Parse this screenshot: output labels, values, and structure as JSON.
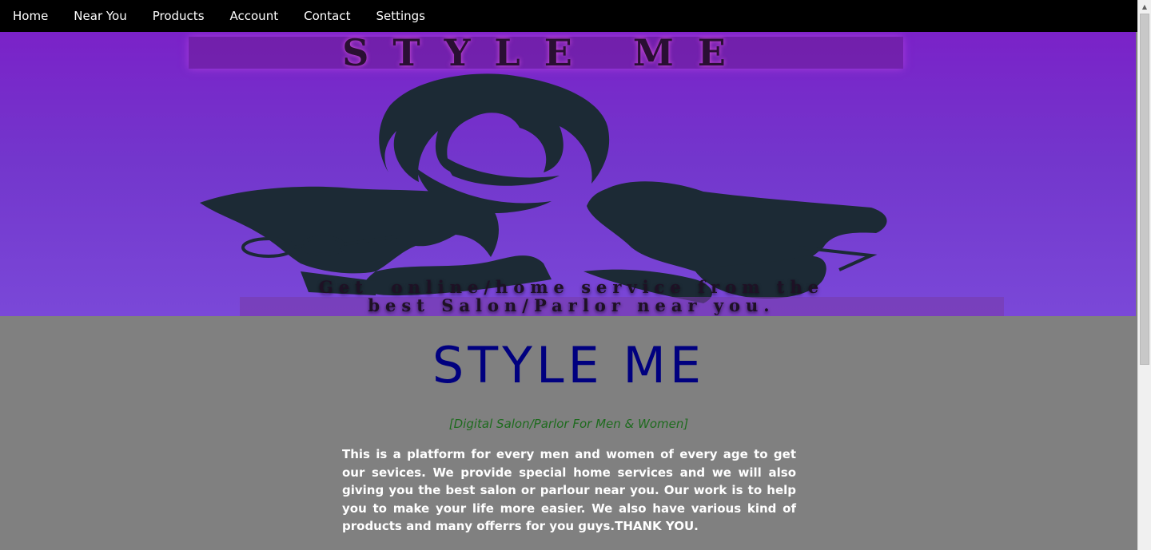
{
  "nav": {
    "items": [
      "Home",
      "Near You",
      "Products",
      "Account",
      "Contact",
      "Settings"
    ]
  },
  "banner": {
    "title": "STYLE ME",
    "tagline_line1": "Get  online/home service from the",
    "tagline_line2": "best Salon/Parlor near you."
  },
  "main": {
    "title": "STYLE ME",
    "subtitle": "[Digital Salon/Parlor For Men & Women]",
    "description": "This is a platform for every men and women of every age to get our sevices. We provide special home services and we will also giving you the best salon or parlour near you. Our work is to help you to make your life more easier. We also have various kind of products and many offerrs for you guys.THANK YOU."
  },
  "colors": {
    "navbar_bg": "#000000",
    "banner_purple": "#7a3ad0",
    "page_bg": "#808080",
    "title_blue": "#00007f",
    "subtitle_green": "#1e6b1e"
  }
}
